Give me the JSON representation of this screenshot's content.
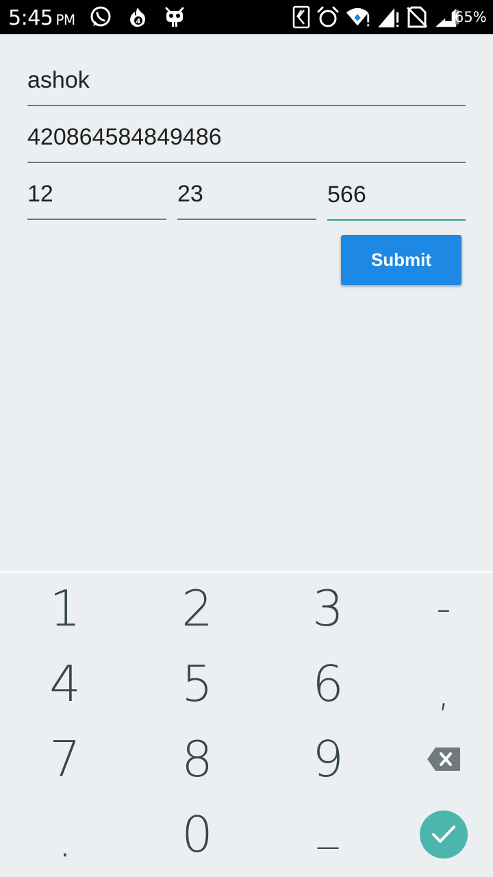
{
  "status_bar": {
    "time": "5:45",
    "ampm": "PM",
    "battery": "65%",
    "left_icons": [
      "whatsapp-icon",
      "fire-notification-icon",
      "android-robot-icon"
    ],
    "right_icons": [
      "nfc-icon",
      "alarm-icon",
      "wifi-icon",
      "signal-icon",
      "no-sim-icon",
      "battery-icon"
    ]
  },
  "form": {
    "name_value": "ashok",
    "card_number_value": "420864584849486",
    "month_value": "12",
    "year_value": "23",
    "cvv_value": "566",
    "submit_label": "Submit"
  },
  "keyboard": {
    "keys": [
      "1",
      "2",
      "3",
      "-",
      "4",
      "5",
      "6",
      ",",
      "7",
      "8",
      "9",
      ".",
      "0",
      "_"
    ],
    "backspace_icon": "backspace-icon",
    "enter_icon": "checkmark-icon",
    "accent_color": "#4db6ac"
  },
  "colors": {
    "button": "#1e88e5",
    "active_underline": "#26a69a"
  }
}
